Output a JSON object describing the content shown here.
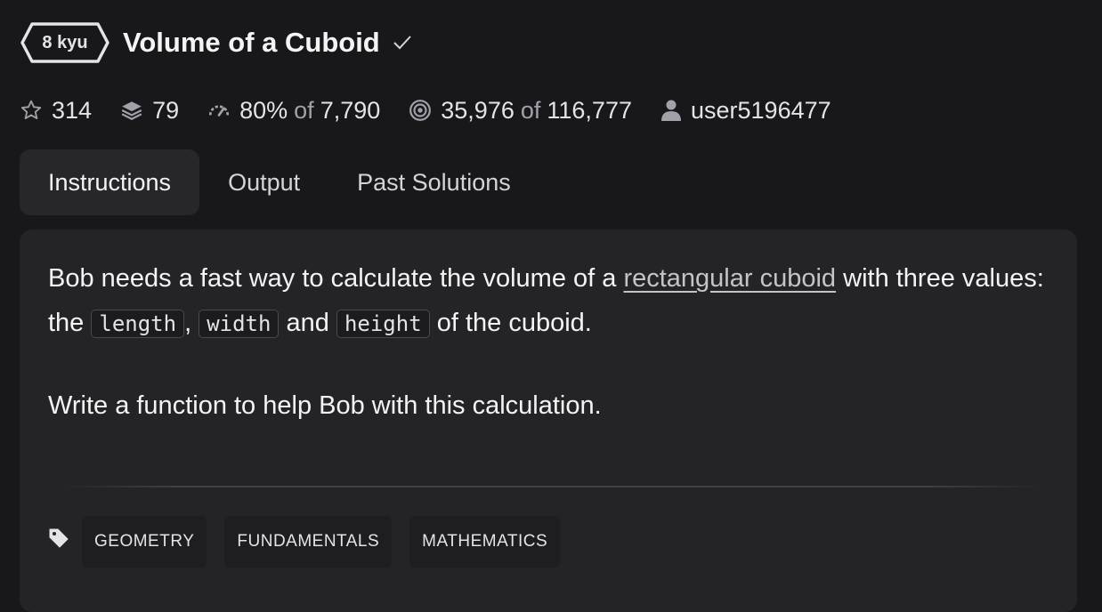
{
  "kata": {
    "rank": "8 kyu",
    "title": "Volume of a Cuboid"
  },
  "stats": {
    "stars": "314",
    "collections": "79",
    "satisfaction_percent": "80%",
    "satisfaction_of": "of",
    "satisfaction_votes": "7,790",
    "completed": "35,976",
    "completed_of": "of",
    "attempted": "116,777",
    "author": "user5196477"
  },
  "tabs": [
    {
      "label": "Instructions",
      "active": true
    },
    {
      "label": "Output",
      "active": false
    },
    {
      "label": "Past Solutions",
      "active": false
    }
  ],
  "description": {
    "p1_text1": "Bob needs a fast way to calculate the volume of a ",
    "p1_link": "rectangular cuboid",
    "p1_text2": " with three values: the ",
    "code1": "length",
    "sep1": ", ",
    "code2": "width",
    "sep2": " and ",
    "code3": "height",
    "p1_text3": " of the cuboid.",
    "p2": "Write a function to help Bob with this calculation."
  },
  "tags": [
    "GEOMETRY",
    "FUNDAMENTALS",
    "MATHEMATICS"
  ],
  "icons": {
    "check": "check-icon",
    "stars": "star-icon",
    "collections": "layers-icon",
    "satisfaction": "speedometer-icon",
    "completed": "target-icon",
    "author": "user-icon",
    "tags": "tag-icon"
  },
  "colors": {
    "background": "#18181b",
    "panel": "#242427",
    "active_tab": "#27272a",
    "text": "#f4f4f5",
    "muted": "#a1a1aa"
  }
}
